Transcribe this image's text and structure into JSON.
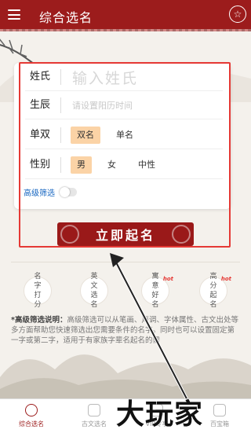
{
  "header": {
    "title": "综合选名",
    "menu_icon": "menu-icon",
    "star_icon": "star-icon"
  },
  "form": {
    "surname_label": "姓氏",
    "surname_placeholder": "输入姓氏",
    "birth_label": "生辰",
    "birth_placeholder": "请设置阳历时间",
    "single_double_label": "单双",
    "single_double_options": [
      "双名",
      "单名"
    ],
    "single_double_selected": "双名",
    "gender_label": "性别",
    "gender_options": [
      "男",
      "女",
      "中性"
    ],
    "gender_selected": "男",
    "advanced_filter_label": "高级筛选",
    "advanced_filter_on": false
  },
  "submit_label": "立即起名",
  "quick_links": [
    {
      "label": "名字打分",
      "hot": false
    },
    {
      "label": "英文选名",
      "hot": false
    },
    {
      "label": "寓意好名",
      "hot": true
    },
    {
      "label": "高分起名",
      "hot": true
    }
  ],
  "hot_badge": "hot",
  "note": {
    "title": "*高级筛选说明：",
    "text": "高级筛选可以从笔画、声调、字体属性、古文出处等多方面帮助您快速筛选出您需要条件的名字。同时也可以设置固定第一字或第二字，适用于有家族字辈名起名的需"
  },
  "tabs": [
    {
      "label": "综合选名",
      "active": true
    },
    {
      "label": "古文选名",
      "active": false
    },
    {
      "label": "VIP专享",
      "active": false
    },
    {
      "label": "百宝箱",
      "active": false
    }
  ],
  "watermark": "大玩家",
  "colors": {
    "brand": "#9c1c1c",
    "highlight": "#e53935",
    "selected_pill": "#fbd3a6",
    "link": "#1565c0"
  }
}
